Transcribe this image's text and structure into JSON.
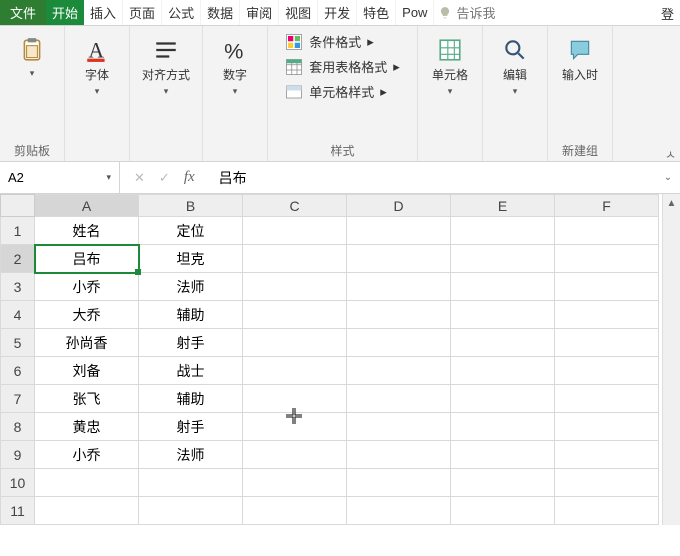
{
  "menu": {
    "file": "文件",
    "tabs": [
      "开始",
      "插入",
      "页面",
      "公式",
      "数据",
      "审阅",
      "视图",
      "开发",
      "特色",
      "Pow"
    ],
    "tell_me": "告诉我",
    "login": "登"
  },
  "ribbon": {
    "clipboard": {
      "label": "剪贴板",
      "paste": "粘贴"
    },
    "font_group": "字体",
    "align_group": "对齐方式",
    "number_group": "数字",
    "styles": {
      "group_label": "样式",
      "cond_fmt": "条件格式",
      "table_fmt": "套用表格格式",
      "cell_style": "单元格样式"
    },
    "cells_group": "单元格",
    "editing_group": "编辑",
    "insert_time": "输入时",
    "new_group": "新建组"
  },
  "fbar": {
    "namebox": "A2",
    "formula": "吕布"
  },
  "columns": [
    "A",
    "B",
    "C",
    "D",
    "E",
    "F"
  ],
  "rows": [
    "1",
    "2",
    "3",
    "4",
    "5",
    "6",
    "7",
    "8",
    "9",
    "10",
    "11"
  ],
  "cells": {
    "A1": "姓名",
    "B1": "定位",
    "A2": "吕布",
    "B2": "坦克",
    "A3": "小乔",
    "B3": "法师",
    "A4": "大乔",
    "B4": "辅助",
    "A5": "孙尚香",
    "B5": "射手",
    "A6": "刘备",
    "B6": "战士",
    "A7": "张飞",
    "B7": "辅助",
    "A8": "黄忠",
    "B8": "射手",
    "A9": "小乔",
    "B9": "法师"
  },
  "active_cell": "A2"
}
